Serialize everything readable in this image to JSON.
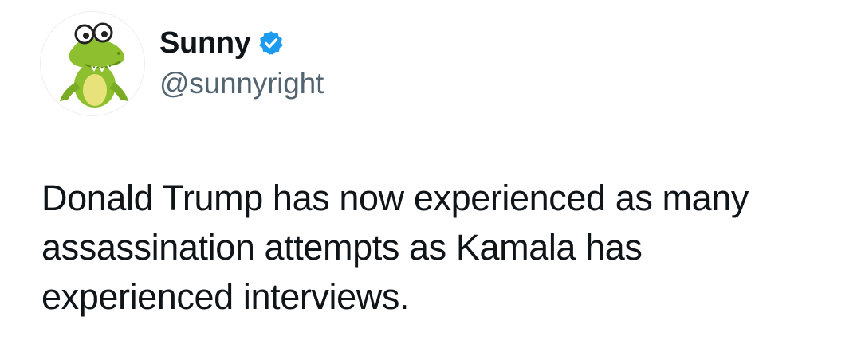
{
  "author": {
    "display_name": "Sunny",
    "handle": "@sunnyright",
    "verified": true,
    "verified_color": "#1d9bf0",
    "avatar_icon": "cartoon-crocodile-with-glasses"
  },
  "tweet": {
    "lines": [
      "Donald Trump has now experienced as many",
      "assassination attempts as Kamala has",
      "experienced interviews."
    ]
  },
  "colors": {
    "text": "#0f1419",
    "secondary_text": "#536471",
    "background": "#ffffff"
  }
}
